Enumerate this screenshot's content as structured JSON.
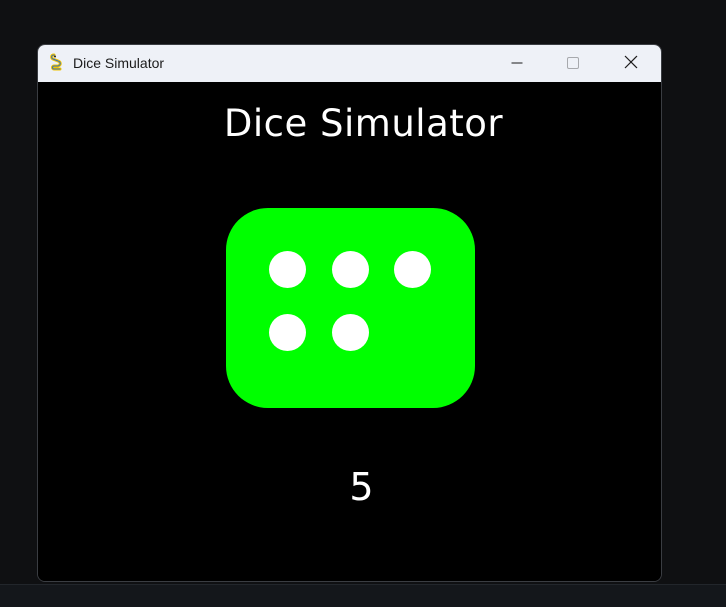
{
  "window": {
    "title": "Dice Simulator",
    "icon": "pygame-snake-icon",
    "controls": [
      "minimize-icon",
      "maximize-icon",
      "close-icon"
    ]
  },
  "game": {
    "title": "Dice Simulator",
    "result": "5",
    "die_color": "#00ff00",
    "pip_color": "#ffffff",
    "background": "#000000",
    "pips_shown": 5
  }
}
